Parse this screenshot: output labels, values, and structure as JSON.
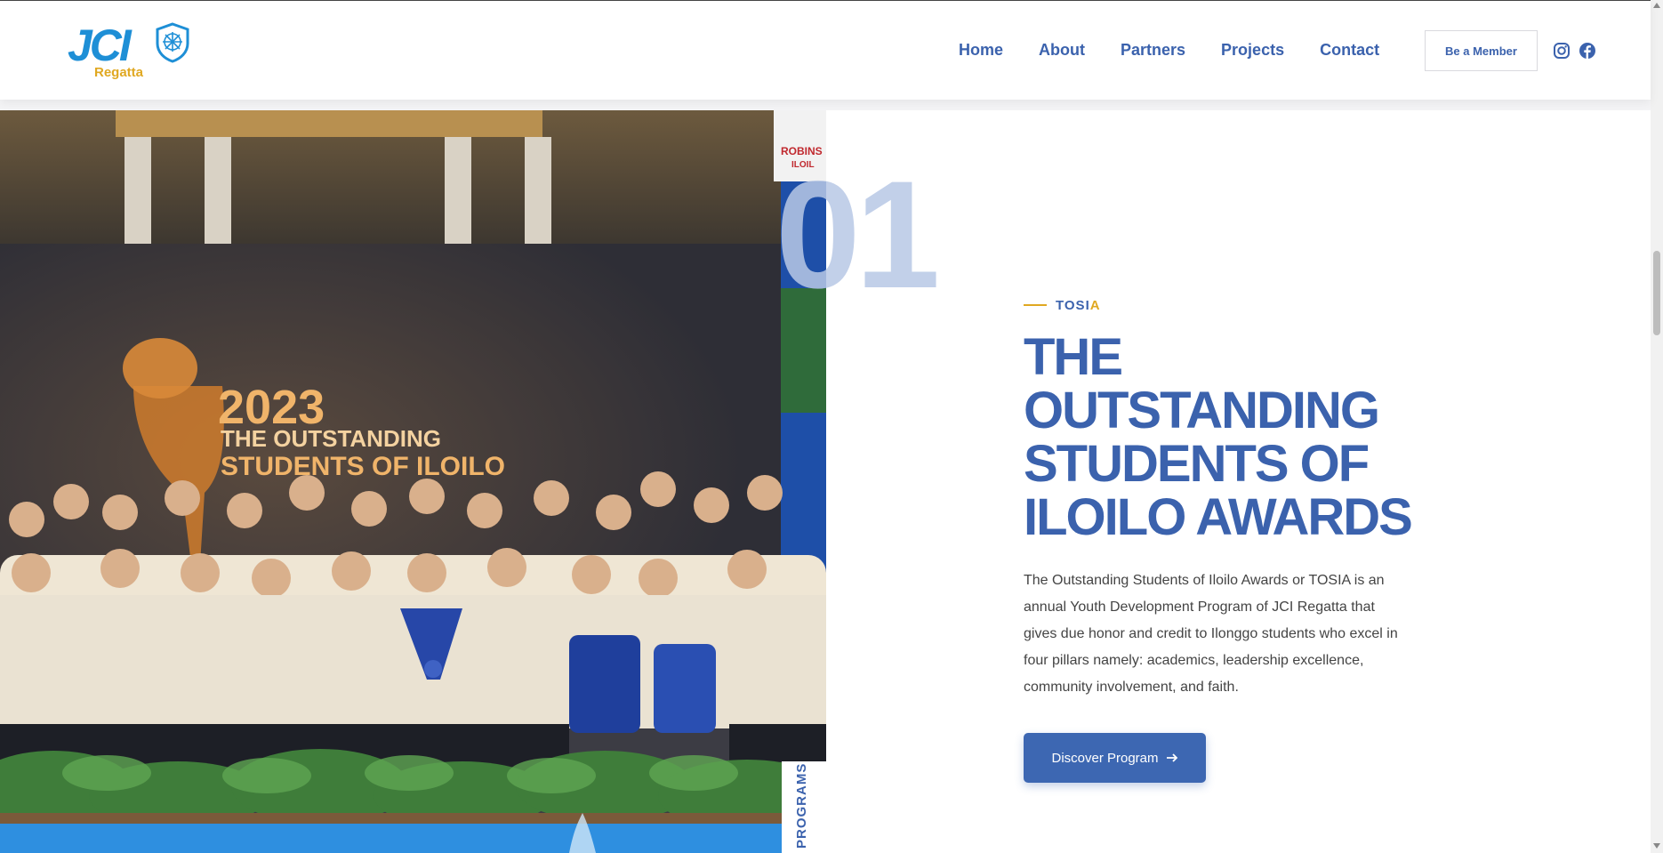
{
  "brand": {
    "logo_text": "JCI",
    "logo_sub": "Regatta"
  },
  "nav": {
    "items": [
      {
        "label": "Home"
      },
      {
        "label": "About"
      },
      {
        "label": "Partners"
      },
      {
        "label": "Projects"
      },
      {
        "label": "Contact"
      }
    ],
    "member_button": "Be a Member",
    "social": [
      {
        "icon": "instagram-icon"
      },
      {
        "icon": "facebook-icon"
      }
    ]
  },
  "hero_photo": {
    "stage_text_year": "2023",
    "stage_text_line1": "THE OUTSTANDING",
    "stage_text_line2": "STUDENTS OF ILOILO",
    "sign_text_1": "ROBINS",
    "sign_text_2": "ILOIL"
  },
  "vertical_tab": "PROGRAMS",
  "program": {
    "number": "01",
    "kicker_main": "TOSI",
    "kicker_highlight": "A",
    "title": "THE OUTSTANDING STUDENTS OF ILOILO AWARDS",
    "description": "The Outstanding Students of Iloilo Awards or TOSIA is an annual Youth Development Program of JCI Regatta that gives due honor and credit to Ilonggo students who excel in four pillars namely: academics, leadership excellence, community involvement, and faith.",
    "cta_label": "Discover Program",
    "cta_icon": "arrow-right-icon"
  },
  "colors": {
    "brand_blue": "#3b62ad",
    "logo_blue": "#1e8fd6",
    "accent_gold": "#e0a821",
    "faint_number": "#b8c8e6"
  }
}
